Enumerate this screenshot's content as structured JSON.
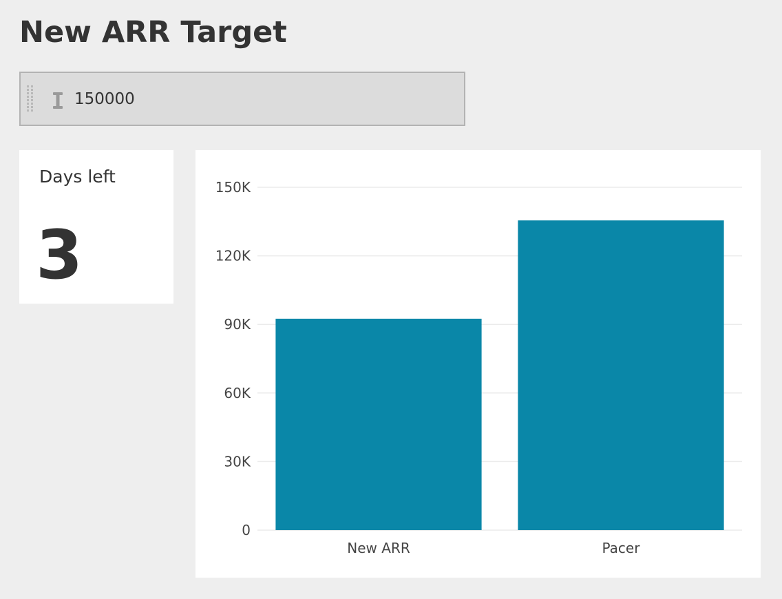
{
  "header": {
    "title": "New ARR Target"
  },
  "filter": {
    "value": "150000"
  },
  "kpi": {
    "label": "Days left",
    "value": "3"
  },
  "colors": {
    "background": "#eeeeee",
    "card": "#ffffff",
    "bar": "#0a87a8",
    "text": "#333333"
  },
  "chart_data": {
    "type": "bar",
    "categories": [
      "New ARR",
      "Pacer"
    ],
    "values": [
      92500,
      135500
    ],
    "ylim": [
      0,
      150000
    ],
    "yticks": [
      {
        "value": 0,
        "label": "0"
      },
      {
        "value": 30000,
        "label": "30K"
      },
      {
        "value": 60000,
        "label": "60K"
      },
      {
        "value": 90000,
        "label": "90K"
      },
      {
        "value": 120000,
        "label": "120K"
      },
      {
        "value": 150000,
        "label": "150K"
      }
    ],
    "grid": true,
    "legend": "none",
    "color": "#0a87a8"
  }
}
